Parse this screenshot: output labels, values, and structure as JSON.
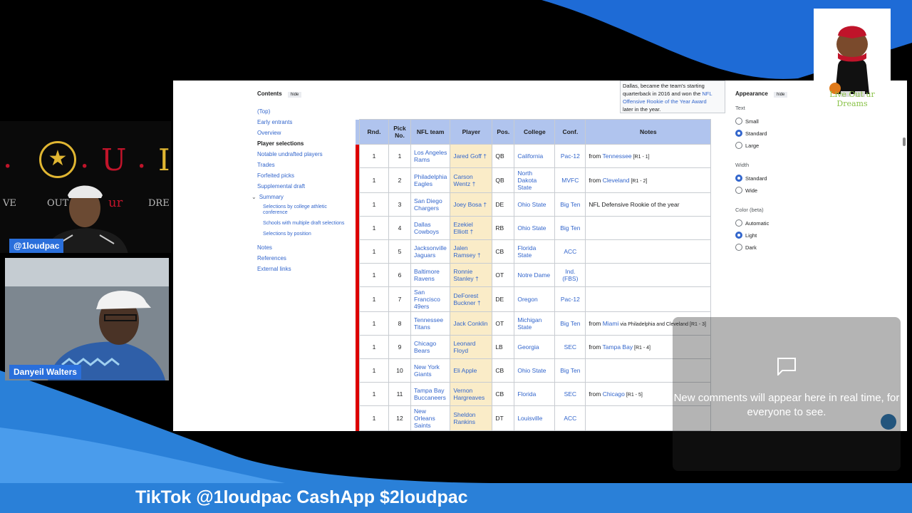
{
  "cam1": {
    "logo_letters": ". ★ . U . I",
    "tagline_left": "VE",
    "tagline_mid": "OUT",
    "tagline_ur": "ur",
    "tagline_right": "DRE",
    "name_tag": "@1loudpac"
  },
  "cam2": {
    "name_tag": "Danyeil Walters"
  },
  "toc": {
    "title": "Contents",
    "hide": "hide",
    "items": [
      "(Top)",
      "Early entrants",
      "Overview",
      "Player selections",
      "Notable undrafted players",
      "Trades",
      "Forfeited picks",
      "Supplemental draft",
      "Summary"
    ],
    "sub_items": [
      "Selections by college athletic conference",
      "Schools with multiple draft selections",
      "Selections by position"
    ],
    "tail_items": [
      "Notes",
      "References",
      "External links"
    ]
  },
  "top_note": {
    "line1": "Dallas, became the team's starting",
    "line2": "quarterback in 2016 and won the ",
    "link": "NFL Offensive Rookie of the Year Award",
    "line3": "later in the year."
  },
  "table": {
    "headers": [
      "Rnd.",
      "Pick No.",
      "NFL team",
      "Player",
      "Pos.",
      "College",
      "Conf.",
      "Notes"
    ],
    "rows": [
      {
        "rnd": "1",
        "pick": "1",
        "team": "Los Angeles Rams",
        "player": "Jared Goff †",
        "pos": "QB",
        "college": "California",
        "conf": "Pac-12",
        "note_pre": "from ",
        "note_link": "Tennessee",
        "note_post": " [R1 - 1]"
      },
      {
        "rnd": "1",
        "pick": "2",
        "team": "Philadelphia Eagles",
        "player": "Carson Wentz †",
        "pos": "QB",
        "college": "North Dakota State",
        "conf": "MVFC",
        "note_pre": "from ",
        "note_link": "Cleveland",
        "note_post": " [R1 - 2]"
      },
      {
        "rnd": "1",
        "pick": "3",
        "team": "San Diego Chargers",
        "player": "Joey Bosa †",
        "pos": "DE",
        "college": "Ohio State",
        "conf": "Big Ten",
        "note_pre": "NFL Defensive Rookie of the year",
        "note_link": "",
        "note_post": ""
      },
      {
        "rnd": "1",
        "pick": "4",
        "team": "Dallas Cowboys",
        "player": "Ezekiel Elliott †",
        "pos": "RB",
        "college": "Ohio State",
        "conf": "Big Ten",
        "note_pre": "",
        "note_link": "",
        "note_post": ""
      },
      {
        "rnd": "1",
        "pick": "5",
        "team": "Jacksonville Jaguars",
        "player": "Jalen Ramsey †",
        "pos": "CB",
        "college": "Florida State",
        "conf": "ACC",
        "note_pre": "",
        "note_link": "",
        "note_post": ""
      },
      {
        "rnd": "1",
        "pick": "6",
        "team": "Baltimore Ravens",
        "player": "Ronnie Stanley †",
        "pos": "OT",
        "college": "Notre Dame",
        "conf": "Ind. (FBS)",
        "note_pre": "",
        "note_link": "",
        "note_post": ""
      },
      {
        "rnd": "1",
        "pick": "7",
        "team": "San Francisco 49ers",
        "player": "DeForest Buckner †",
        "pos": "DE",
        "college": "Oregon",
        "conf": "Pac-12",
        "note_pre": "",
        "note_link": "",
        "note_post": ""
      },
      {
        "rnd": "1",
        "pick": "8",
        "team": "Tennessee Titans",
        "player": "Jack Conklin",
        "pos": "OT",
        "college": "Michigan State",
        "conf": "Big Ten",
        "note_pre": "from ",
        "note_link": "Miami",
        "note_post": " via Philadelphia and Cleveland [R1 - 3]"
      },
      {
        "rnd": "1",
        "pick": "9",
        "team": "Chicago Bears",
        "player": "Leonard Floyd",
        "pos": "LB",
        "college": "Georgia",
        "conf": "SEC",
        "note_pre": "from ",
        "note_link": "Tampa Bay",
        "note_post": " [R1 - 4]"
      },
      {
        "rnd": "1",
        "pick": "10",
        "team": "New York Giants",
        "player": "Eli Apple",
        "pos": "CB",
        "college": "Ohio State",
        "conf": "Big Ten",
        "note_pre": "",
        "note_link": "",
        "note_post": ""
      },
      {
        "rnd": "1",
        "pick": "11",
        "team": "Tampa Bay Buccaneers",
        "player": "Vernon Hargreaves",
        "pos": "CB",
        "college": "Florida",
        "conf": "SEC",
        "note_pre": "from ",
        "note_link": "Chicago",
        "note_post": " [R1 - 5]"
      },
      {
        "rnd": "1",
        "pick": "12",
        "team": "New Orleans Saints",
        "player": "Sheldon Rankins",
        "pos": "DT",
        "college": "Louisville",
        "conf": "ACC",
        "note_pre": "",
        "note_link": "",
        "note_post": ""
      }
    ]
  },
  "appearance": {
    "title": "Appearance",
    "hide": "hide",
    "text_label": "Text",
    "text_options": [
      "Small",
      "Standard",
      "Large"
    ],
    "text_selected": 1,
    "width_label": "Width",
    "width_options": [
      "Standard",
      "Wide"
    ],
    "width_selected": 0,
    "color_label": "Color (beta)",
    "color_options": [
      "Automatic",
      "Light",
      "Dark"
    ],
    "color_selected": 1
  },
  "mascot": {
    "slogan": "Live Out ur Dreams"
  },
  "comments": {
    "message": "New comments will appear here in real time, for everyone to see."
  },
  "banner": {
    "text": "TikTok @1loudpac CashApp $2loudpac"
  },
  "colors": {
    "accent": "#2a80d8",
    "header": "#b0c4ee",
    "player_bg": "#faecc8",
    "row_stripe": "#dd0000"
  }
}
